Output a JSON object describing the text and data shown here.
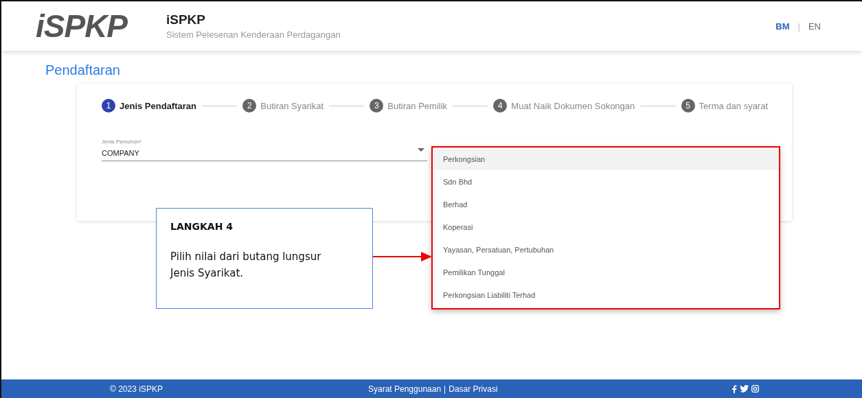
{
  "header": {
    "logo_text": "iSPKP",
    "app_name": "iSPKP",
    "subtitle": "Sistem Pelesenan Kenderaan Perdagangan",
    "lang_separator": "|",
    "languages": [
      {
        "label": "BM",
        "selected": true
      },
      {
        "label": "EN",
        "selected": false
      }
    ]
  },
  "page_title": "Pendaftaran",
  "steps": [
    {
      "number": "1",
      "label": "Jenis Pendaftaran",
      "selected": true
    },
    {
      "number": "2",
      "label": "Butiran Syarikat",
      "selected": false
    },
    {
      "number": "3",
      "label": "Butiran Pemilik",
      "selected": false
    },
    {
      "number": "4",
      "label": "Muat Naik Dokumen Sokongan",
      "selected": false
    },
    {
      "number": "5",
      "label": "Terma dan syarat",
      "selected": false
    }
  ],
  "field": {
    "label": "Jenis Pemohon*",
    "value": "COMPANY"
  },
  "dropdown": {
    "options": [
      {
        "label": "Perkongsian",
        "selected": true
      },
      {
        "label": "Sdn Bhd",
        "selected": false
      },
      {
        "label": "Berhad",
        "selected": false
      },
      {
        "label": "Koperasi",
        "selected": false
      },
      {
        "label": "Yayasan, Persatuan, Pertubuhan",
        "selected": false
      },
      {
        "label": "Pemilikan Tunggal",
        "selected": false
      },
      {
        "label": "Perkongsian Liabiliti Terhad",
        "selected": false
      }
    ]
  },
  "callout": {
    "title": "LANGKAH 4",
    "text": "Pilih nilai dari butang lungsur Jenis Syarikat."
  },
  "footer": {
    "copyright": "© 2023 iSPKP",
    "links": [
      "Syarat Penggunaan",
      "Dasar Privasi"
    ],
    "separator": "|"
  }
}
